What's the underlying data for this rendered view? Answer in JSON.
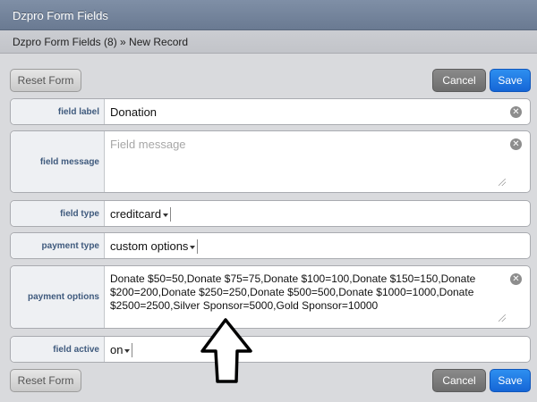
{
  "window": {
    "title": "Dzpro Form Fields"
  },
  "breadcrumb": {
    "text": "Dzpro Form Fields (8) » New Record"
  },
  "toolbar": {
    "reset_label": "Reset Form",
    "cancel_label": "Cancel",
    "save_label": "Save"
  },
  "fields": {
    "label": {
      "label": "field label",
      "value": "Donation"
    },
    "message": {
      "label": "field message",
      "placeholder": "Field message"
    },
    "type": {
      "label": "field type",
      "value": "creditcard"
    },
    "payment_type": {
      "label": "payment type",
      "value": "custom options"
    },
    "payment_options": {
      "label": "payment options",
      "value": "Donate $50=50,Donate $75=75,Donate $100=100,Donate $150=150,Donate $200=200,Donate $250=250,Donate $500=500,Donate $1000=1000,Donate $2500=2500,Silver Sponsor=5000,Gold Sponsor=10000"
    },
    "active": {
      "label": "field active",
      "value": "on"
    }
  },
  "colors": {
    "save": "#1a6fe0",
    "cancel": "#7a7a7a",
    "title_bar": "#7384a0",
    "label_text": "#3f5a7d"
  },
  "icons": {
    "clear": "clear-icon",
    "resize": "resize-grip-icon",
    "annotation": "arrow-up-icon"
  }
}
